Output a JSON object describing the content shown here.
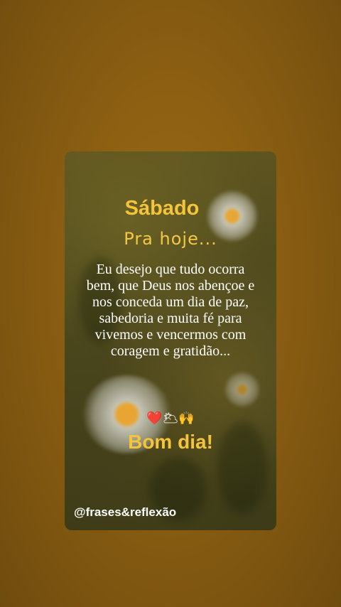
{
  "card": {
    "title": "Sábado",
    "subtitle": "Pra hoje...",
    "message": "Eu desejo que tudo ocorra bem, que Deus nos abençoe e nos conceda um dia de paz, sabedoria e muita fé para vivemos e vencermos com coragem e gratidão...",
    "emojis": {
      "heart": "❤️",
      "sun_cloud": "🌥",
      "raised_hands": "🙌"
    },
    "greeting": "Bom dia!",
    "watermark": "@frases&reflexão"
  },
  "colors": {
    "background": "#8c5f12",
    "accent_text": "#f4c43a",
    "body_text": "#ffffff"
  }
}
